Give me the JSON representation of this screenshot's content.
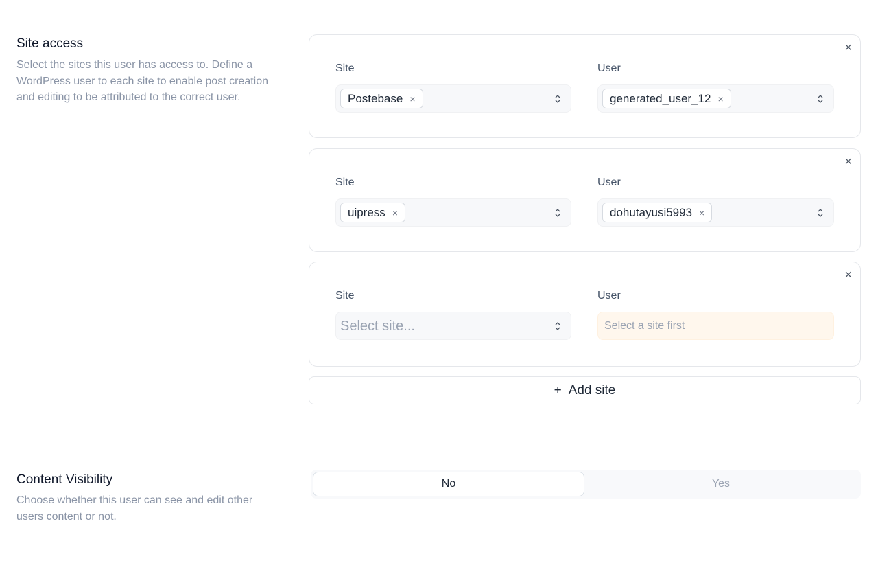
{
  "site_access": {
    "title": "Site access",
    "description": "Select the sites this user has access to. Define a WordPress user to each site to enable post creation and editing to be attributed to the correct user."
  },
  "site_label": "Site",
  "user_label": "User",
  "rows": [
    {
      "site": "Postebase",
      "user": "generated_user_12"
    },
    {
      "site": "uipress",
      "user": "dohutayusi5993"
    },
    {
      "site_placeholder": "Select site...",
      "user_placeholder": "Select a site first"
    }
  ],
  "add_site": {
    "icon": "+",
    "label": "Add site"
  },
  "content_visibility": {
    "title": "Content Visibility",
    "description": "Choose whether this user can see and edit other users content or not.",
    "options": [
      "No",
      "Yes"
    ],
    "selected": "No"
  },
  "icons": {
    "remove": "×",
    "close": "×"
  }
}
